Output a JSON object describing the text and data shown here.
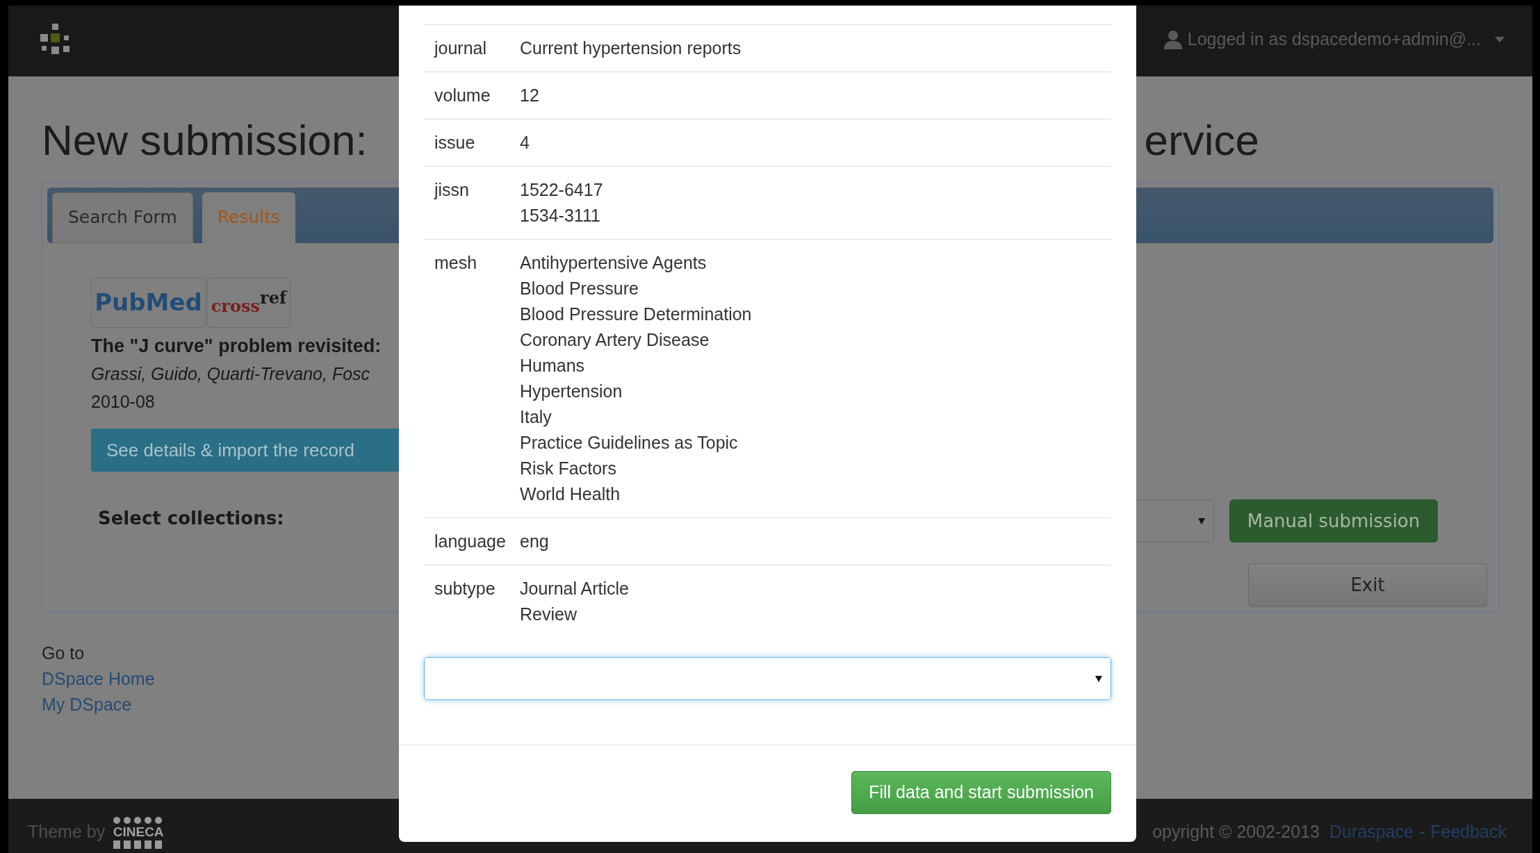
{
  "header": {
    "user": "Logged in as dspacedemo+admin@..."
  },
  "page": {
    "title_start": "New submission:",
    "title_end": "ervice",
    "tabs": [
      {
        "label": "Search Form",
        "selected": false
      },
      {
        "label": "Results",
        "selected": true
      }
    ],
    "result": {
      "pubmed_logo": "PubMed",
      "crossref_logo": [
        "cross",
        "ref"
      ],
      "title": "The \"J curve\" problem revisited:",
      "authors": "Grassi, Guido, Quarti-Trevano, Fosc",
      "date": "2010-08",
      "import_button": "See details & import the record"
    },
    "select_collections_label": "Select collections:",
    "manual_button": "Manual submission",
    "exit_button": "Exit"
  },
  "goto": {
    "label": "Go to",
    "links": [
      "DSpace Home",
      "My DSpace"
    ]
  },
  "footer": {
    "theme_by": "Theme by",
    "cineca_logo": "CINECA",
    "copyright": "opyright © 2002-2013",
    "links": [
      "Duraspace",
      "Feedback"
    ],
    "separator": "-"
  },
  "modal": {
    "fields": [
      {
        "label": "journal",
        "values": [
          "Current hypertension reports"
        ]
      },
      {
        "label": "volume",
        "values": [
          "12"
        ]
      },
      {
        "label": "issue",
        "values": [
          "4"
        ]
      },
      {
        "label": "jissn",
        "values": [
          "1522-6417",
          "1534-3111"
        ]
      },
      {
        "label": "mesh",
        "values": [
          "Antihypertensive Agents",
          "Blood Pressure",
          "Blood Pressure Determination",
          "Coronary Artery Disease",
          "Humans",
          "Hypertension",
          "Italy",
          "Practice Guidelines as Topic",
          "Risk Factors",
          "World Health"
        ]
      },
      {
        "label": "language",
        "values": [
          "eng"
        ]
      },
      {
        "label": "subtype",
        "values": [
          "Journal Article",
          "Review"
        ]
      }
    ],
    "submit_button": "Fill data and start submission"
  }
}
